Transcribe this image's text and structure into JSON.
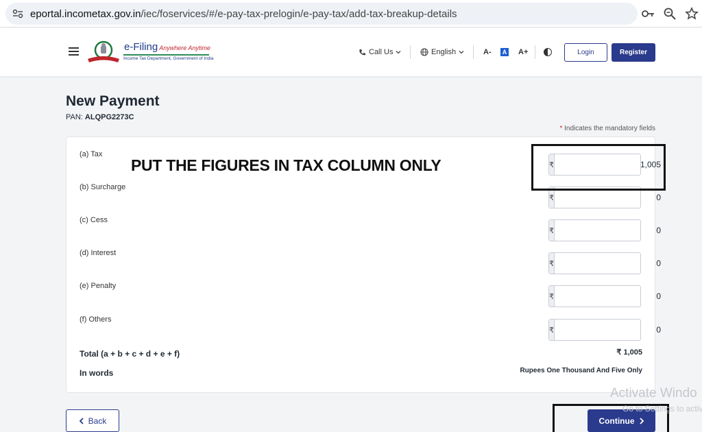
{
  "browser": {
    "url_host": "eportal.incometax.gov.in",
    "url_path": "/iec/foservices/#/e-pay-tax-prelogin/e-pay-tax/add-tax-breakup-details",
    "icons": [
      "site-settings-icon",
      "key-icon",
      "zoom-icon",
      "star-icon"
    ]
  },
  "header": {
    "logo_title": "e-Filing",
    "logo_tagline": "Anywhere Anytime",
    "logo_subtitle": "Income Tax Department, Government of India",
    "call_us": "Call Us",
    "language": "English",
    "font_decrease": "A-",
    "font_normal": "A",
    "font_increase": "A+",
    "login_label": "Login",
    "register_label": "Register"
  },
  "page": {
    "title": "New Payment",
    "pan_label": "PAN:",
    "pan_value": "ALQPG2273C",
    "mandatory_star": "*",
    "mandatory_note": "Indicates the mandatory fields"
  },
  "currency_symbol": "₹",
  "fields": [
    {
      "label": "(a) Tax",
      "value": "1,005"
    },
    {
      "label": "(b) Surcharge",
      "value": "0"
    },
    {
      "label": "(c) Cess",
      "value": "0"
    },
    {
      "label": "(d) Interest",
      "value": "0"
    },
    {
      "label": "(e) Penalty",
      "value": "0"
    },
    {
      "label": "(f) Others",
      "value": "0"
    }
  ],
  "total": {
    "label": "Total (a + b + c + d + e + f)",
    "value": "₹ 1,005",
    "words_label": "In words",
    "words_value": "Rupees One Thousand And Five Only"
  },
  "annotation_text": "PUT THE FIGURES IN TAX COLUMN ONLY",
  "footer": {
    "back_label": "Back",
    "continue_label": "Continue"
  },
  "watermark": {
    "title": "Activate Windo",
    "subtitle": "Go to Settings to activ"
  },
  "colors": {
    "primary": "#2a3a8c",
    "mandatory": "#c0262d"
  }
}
